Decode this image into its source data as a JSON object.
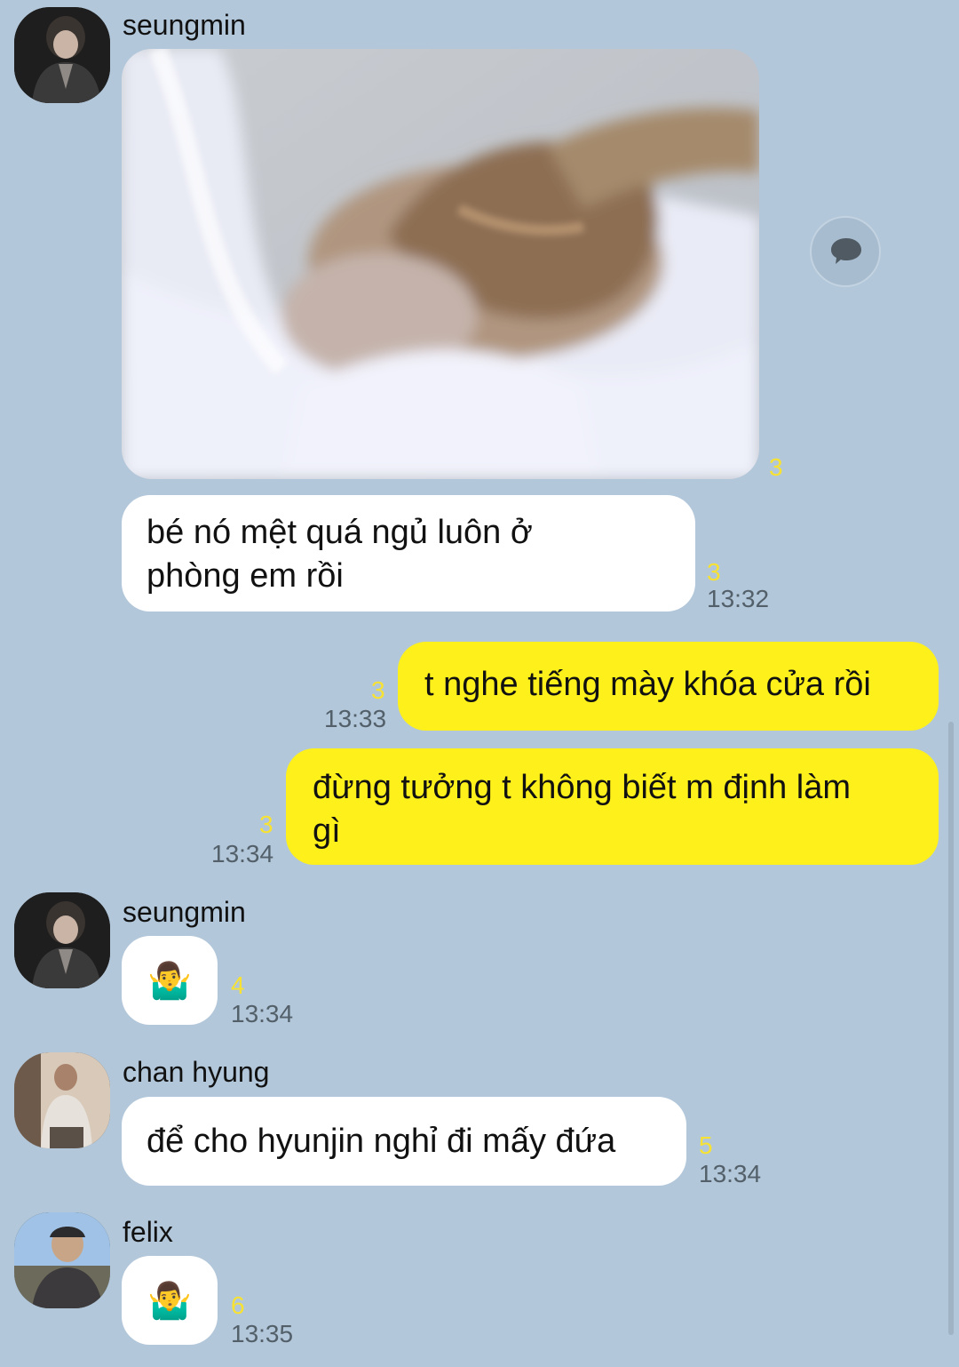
{
  "colors": {
    "background": "#b2c7da",
    "my_bubble": "#fef01b",
    "their_bubble": "#ffffff",
    "unread": "#f7e234"
  },
  "messages": [
    {
      "sender": "seungmin",
      "type": "photo",
      "unread": "3"
    },
    {
      "sender": "seungmin",
      "text": "bé nó mệt quá ngủ luôn ở\nphòng em rồi",
      "unread": "3",
      "time": "13:32"
    },
    {
      "sender": "me",
      "text": "t nghe tiếng mày khóa cửa rồi",
      "unread": "3",
      "time": "13:33"
    },
    {
      "sender": "me",
      "text": "đừng tưởng t không biết m định làm\ngì",
      "unread": "3",
      "time": "13:34"
    },
    {
      "sender": "seungmin",
      "text": "🤷‍♂️",
      "unread": "4",
      "time": "13:34"
    },
    {
      "sender": "chan hyung",
      "text": "để cho hyunjin nghỉ đi mấy đứa",
      "unread": "5",
      "time": "13:34"
    },
    {
      "sender": "felix",
      "text": "🤷‍♂️",
      "unread": "6",
      "time": "13:35"
    }
  ],
  "icons": {
    "share": "speech-bubble-icon"
  }
}
